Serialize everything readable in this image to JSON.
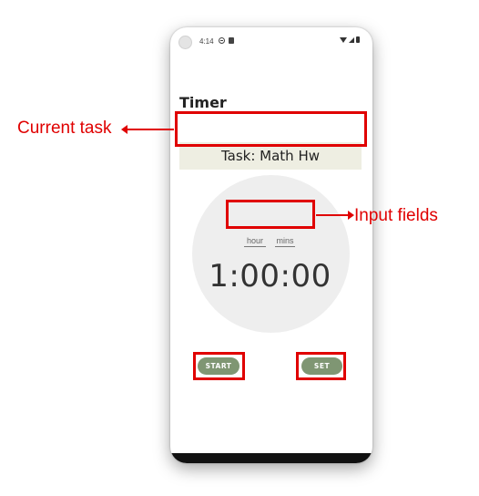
{
  "status_bar": {
    "time": "4:14",
    "icons": [
      "dnd-icon",
      "sd-card-icon",
      "wifi-icon",
      "signal-icon",
      "battery-icon"
    ]
  },
  "app": {
    "title": "Timer",
    "task_label": "Task: Math Hw",
    "hour_placeholder": "hour",
    "mins_placeholder": "mins",
    "countdown": "1:00:00",
    "start_label": "START",
    "set_label": "SET"
  },
  "annotations": {
    "current_task": "Current task",
    "input_fields": "Input fields"
  },
  "colors": {
    "task_background": "#eeeee2",
    "circle_background": "#eeeeee",
    "button": "#7f9673",
    "annotation": "#e00000"
  }
}
